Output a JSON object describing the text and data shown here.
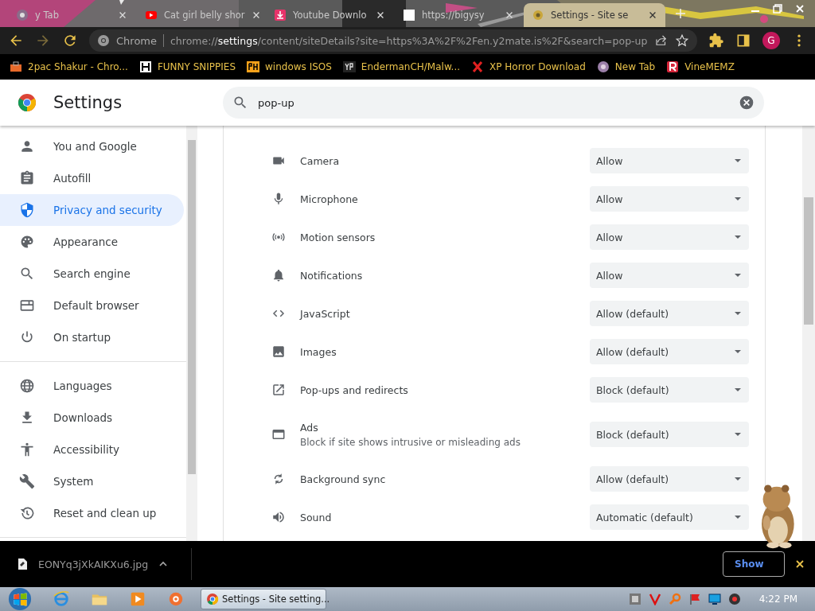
{
  "tabs": [
    {
      "title": "y Tab",
      "selected": false
    },
    {
      "title": "Cat girl belly shor",
      "selected": false
    },
    {
      "title": "Youtube Downlo",
      "selected": false
    },
    {
      "title": "https://bigysy",
      "selected": false
    },
    {
      "title": "Settings - Site se",
      "selected": true
    }
  ],
  "toolbar": {
    "site_label": "Chrome",
    "url": "chrome://**settings**/content/siteDetails?site=https%3A%2F%2Fen.y2mate.is%2F&search=pop-up",
    "profile": "G"
  },
  "bookmarks": [
    {
      "label": "2pac Shakur - Chro..."
    },
    {
      "label": "FUNNY SNIPPIES"
    },
    {
      "label": "windows ISOS"
    },
    {
      "label": "EndermanCH/Malw..."
    },
    {
      "label": "XP Horror Download"
    },
    {
      "label": "New Tab"
    },
    {
      "label": "VineMEMZ"
    }
  ],
  "settings": {
    "title": "Settings",
    "search": {
      "value": "pop-up"
    }
  },
  "sidebar": {
    "groups": [
      {
        "items": [
          {
            "label": "You and Google",
            "selected": false
          },
          {
            "label": "Autofill",
            "selected": false
          },
          {
            "label": "Privacy and security",
            "selected": true
          },
          {
            "label": "Appearance",
            "selected": false
          },
          {
            "label": "Search engine",
            "selected": false
          },
          {
            "label": "Default browser",
            "selected": false
          },
          {
            "label": "On startup",
            "selected": false
          }
        ]
      },
      {
        "items": [
          {
            "label": "Languages",
            "selected": false
          },
          {
            "label": "Downloads",
            "selected": false
          },
          {
            "label": "Accessibility",
            "selected": false
          },
          {
            "label": "System",
            "selected": false
          },
          {
            "label": "Reset and clean up",
            "selected": false
          }
        ]
      }
    ]
  },
  "permissions": [
    {
      "label": "Camera",
      "value": "Allow"
    },
    {
      "label": "Microphone",
      "value": "Allow"
    },
    {
      "label": "Motion sensors",
      "value": "Allow"
    },
    {
      "label": "Notifications",
      "value": "Allow"
    },
    {
      "label": "JavaScript",
      "value": "Allow (default)"
    },
    {
      "label": "Images",
      "value": "Allow (default)"
    },
    {
      "label": "Pop-ups and redirects",
      "value": "Block (default)"
    },
    {
      "label": "Ads",
      "description": "Block if site shows intrusive or misleading ads",
      "value": "Block (default)"
    },
    {
      "label": "Background sync",
      "value": "Allow (default)"
    },
    {
      "label": "Sound",
      "value": "Automatic (default)"
    }
  ],
  "download_bar": {
    "file": "EONYq3jXkAIKXu6.jpg",
    "button": "Show"
  },
  "taskbar": {
    "task": "Settings - Site setting...",
    "clock": "4:22 PM"
  }
}
